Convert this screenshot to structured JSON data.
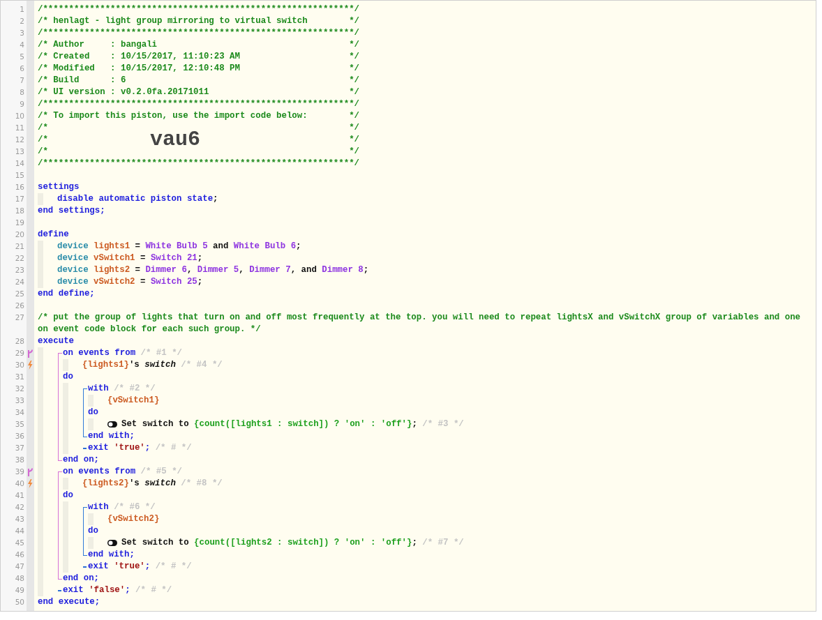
{
  "editor": {
    "lines": [
      {
        "kind": "line",
        "num": "1",
        "segments": [
          {
            "kind": "comment",
            "text": "/************************************************************/"
          }
        ]
      },
      {
        "kind": "line",
        "num": "2",
        "segments": [
          {
            "kind": "comment",
            "text": "/* henlagt - light group mirroring to virtual switch"
          }
        ],
        "tail": "*/"
      },
      {
        "kind": "line",
        "num": "3",
        "segments": [
          {
            "kind": "comment",
            "text": "/************************************************************/"
          }
        ]
      },
      {
        "kind": "line",
        "num": "4",
        "segments": [
          {
            "kind": "comment",
            "text": "/* Author     : bangali"
          }
        ],
        "tail": "*/"
      },
      {
        "kind": "line",
        "num": "5",
        "segments": [
          {
            "kind": "comment",
            "text": "/* Created    : 10/15/2017, 11:10:23 AM"
          }
        ],
        "tail": "*/"
      },
      {
        "kind": "line",
        "num": "6",
        "segments": [
          {
            "kind": "comment",
            "text": "/* Modified   : 10/15/2017, 12:10:48 PM"
          }
        ],
        "tail": "*/"
      },
      {
        "kind": "line",
        "num": "7",
        "segments": [
          {
            "kind": "comment",
            "text": "/* Build      : 6"
          }
        ],
        "tail": "*/"
      },
      {
        "kind": "line",
        "num": "8",
        "segments": [
          {
            "kind": "comment",
            "text": "/* UI version : v0.2.0fa.20171011"
          }
        ],
        "tail": "*/"
      },
      {
        "kind": "line",
        "num": "9",
        "segments": [
          {
            "kind": "comment",
            "text": "/************************************************************/"
          }
        ]
      },
      {
        "kind": "line",
        "num": "10",
        "segments": [
          {
            "kind": "comment",
            "text": "/* To import this piston, use the import code below:"
          }
        ],
        "tail": "*/"
      },
      {
        "kind": "line",
        "num": "11",
        "segments": [
          {
            "kind": "comment",
            "text": "/*"
          }
        ],
        "tail": "*/"
      },
      {
        "kind": "line",
        "num": "12",
        "segments": [
          {
            "kind": "comment",
            "text": "/*"
          },
          {
            "kind": "importcode",
            "text": "vau6"
          }
        ],
        "tail": "*/"
      },
      {
        "kind": "line",
        "num": "13",
        "segments": [
          {
            "kind": "comment",
            "text": "/*"
          }
        ],
        "tail": "*/"
      },
      {
        "kind": "line",
        "num": "14",
        "segments": [
          {
            "kind": "comment",
            "text": "/************************************************************/"
          }
        ]
      },
      {
        "kind": "line",
        "num": "15"
      },
      {
        "kind": "line",
        "num": "16",
        "segments": [
          {
            "kind": "keyword",
            "text": "settings"
          }
        ],
        "children": [
          {
            "kind": "line",
            "num": "17",
            "segments": [
              {
                "kind": "keyword",
                "text": "disable automatic piston state"
              },
              {
                "kind": "plain",
                "text": ";"
              }
            ]
          }
        ]
      },
      {
        "kind": "line",
        "num": "18",
        "segments": [
          {
            "kind": "keyword",
            "text": "end settings;"
          }
        ]
      },
      {
        "kind": "line",
        "num": "19"
      },
      {
        "kind": "line",
        "num": "20",
        "segments": [
          {
            "kind": "keyword",
            "text": "define"
          }
        ],
        "children": [
          {
            "kind": "line",
            "num": "21",
            "segments": [
              {
                "kind": "type",
                "text": "device "
              },
              {
                "kind": "variable",
                "text": "lights1"
              },
              {
                "kind": "plain",
                "text": " = "
              },
              {
                "kind": "device",
                "text": "White Bulb 5"
              },
              {
                "kind": "plain",
                "text": " and "
              },
              {
                "kind": "device",
                "text": "White Bulb 6"
              },
              {
                "kind": "plain",
                "text": ";"
              }
            ]
          },
          {
            "kind": "line",
            "num": "22",
            "segments": [
              {
                "kind": "type",
                "text": "device "
              },
              {
                "kind": "variable",
                "text": "vSwitch1"
              },
              {
                "kind": "plain",
                "text": " = "
              },
              {
                "kind": "device",
                "text": "Switch 21"
              },
              {
                "kind": "plain",
                "text": ";"
              }
            ]
          },
          {
            "kind": "line",
            "num": "23",
            "segments": [
              {
                "kind": "type",
                "text": "device "
              },
              {
                "kind": "variable",
                "text": "lights2"
              },
              {
                "kind": "plain",
                "text": " = "
              },
              {
                "kind": "device",
                "text": "Dimmer 6"
              },
              {
                "kind": "plain",
                "text": ", "
              },
              {
                "kind": "device",
                "text": "Dimmer 5"
              },
              {
                "kind": "plain",
                "text": ", "
              },
              {
                "kind": "device",
                "text": "Dimmer 7"
              },
              {
                "kind": "plain",
                "text": ", and "
              },
              {
                "kind": "device",
                "text": "Dimmer 8"
              },
              {
                "kind": "plain",
                "text": ";"
              }
            ]
          },
          {
            "kind": "line",
            "num": "24",
            "segments": [
              {
                "kind": "type",
                "text": "device "
              },
              {
                "kind": "variable",
                "text": "vSwitch2"
              },
              {
                "kind": "plain",
                "text": " = "
              },
              {
                "kind": "device",
                "text": "Switch 25"
              },
              {
                "kind": "plain",
                "text": ";"
              }
            ]
          }
        ]
      },
      {
        "kind": "line",
        "num": "25",
        "segments": [
          {
            "kind": "keyword",
            "text": "end define;"
          }
        ]
      },
      {
        "kind": "line",
        "num": "26"
      },
      {
        "kind": "line",
        "num": "27",
        "segments": [
          {
            "kind": "comment",
            "text": "/* put the group of lights that turn on and off most frequently at the top. you will need to repeat lightsX and vSwitchX group of variables and one on event code block for each such group. */"
          }
        ]
      },
      {
        "kind": "line",
        "num": "28",
        "segments": [
          {
            "kind": "keyword",
            "text": "execute"
          }
        ],
        "children": [
          {
            "kind": "event_block",
            "lines": [
              {
                "kind": "event",
                "num": "29",
                "segments": [
                  {
                    "kind": "keyword",
                    "text": "on events from"
                  },
                  {
                    "kind": "note",
                    "text": " /* #1 */"
                  }
                ],
                "children": [
                  {
                    "kind": "trigger",
                    "num": "30",
                    "segments": [
                      {
                        "kind": "variable",
                        "text": "{lights1}"
                      },
                      {
                        "kind": "plain",
                        "text": "'s "
                      },
                      {
                        "kind": "attribute",
                        "text": "switch"
                      },
                      {
                        "kind": "note",
                        "text": " /* #4 */"
                      }
                    ]
                  }
                ]
              },
              {
                "kind": "line",
                "num": "31",
                "segments": [
                  {
                    "kind": "keyword",
                    "text": "do"
                  }
                ],
                "children": [
                  {
                    "kind": "with_block",
                    "lines": [
                      {
                        "kind": "line",
                        "num": "32",
                        "segments": [
                          {
                            "kind": "keyword",
                            "text": "with"
                          },
                          {
                            "kind": "note",
                            "text": " /* #2 */"
                          }
                        ],
                        "children": [
                          {
                            "kind": "line",
                            "num": "33",
                            "segments": [
                              {
                                "kind": "variable",
                                "text": "{vSwitch1}"
                              }
                            ]
                          }
                        ]
                      },
                      {
                        "kind": "line",
                        "num": "34",
                        "segments": [
                          {
                            "kind": "keyword",
                            "text": "do"
                          }
                        ],
                        "children": [
                          {
                            "kind": "action",
                            "num": "35",
                            "segments": [
                              {
                                "kind": "plain",
                                "text": "Set switch to "
                              },
                              {
                                "kind": "expression",
                                "text": "{count([lights1 : switch]) ? 'on' : 'off'}"
                              },
                              {
                                "kind": "plain",
                                "text": ";"
                              },
                              {
                                "kind": "note",
                                "text": " /* #3 */"
                              }
                            ]
                          }
                        ]
                      },
                      {
                        "kind": "line",
                        "num": "36",
                        "segments": [
                          {
                            "kind": "keyword",
                            "text": "end with;"
                          }
                        ]
                      }
                    ]
                  },
                  {
                    "kind": "exit",
                    "num": "37",
                    "segments": [
                      {
                        "kind": "keyword",
                        "text": "exit "
                      },
                      {
                        "kind": "string",
                        "text": "'true'"
                      },
                      {
                        "kind": "keyword",
                        "text": ";"
                      },
                      {
                        "kind": "note",
                        "text": " /* # */"
                      }
                    ]
                  }
                ]
              },
              {
                "kind": "line",
                "num": "38",
                "segments": [
                  {
                    "kind": "keyword",
                    "text": "end on;"
                  }
                ]
              }
            ]
          },
          {
            "kind": "event_block",
            "lines": [
              {
                "kind": "event",
                "num": "39",
                "segments": [
                  {
                    "kind": "keyword",
                    "text": "on events from"
                  },
                  {
                    "kind": "note",
                    "text": " /* #5 */"
                  }
                ],
                "children": [
                  {
                    "kind": "trigger",
                    "num": "40",
                    "segments": [
                      {
                        "kind": "variable",
                        "text": "{lights2}"
                      },
                      {
                        "kind": "plain",
                        "text": "'s "
                      },
                      {
                        "kind": "attribute",
                        "text": "switch"
                      },
                      {
                        "kind": "note",
                        "text": " /* #8 */"
                      }
                    ]
                  }
                ]
              },
              {
                "kind": "line",
                "num": "41",
                "segments": [
                  {
                    "kind": "keyword",
                    "text": "do"
                  }
                ],
                "children": [
                  {
                    "kind": "with_block",
                    "lines": [
                      {
                        "kind": "line",
                        "num": "42",
                        "segments": [
                          {
                            "kind": "keyword",
                            "text": "with"
                          },
                          {
                            "kind": "note",
                            "text": " /* #6 */"
                          }
                        ],
                        "children": [
                          {
                            "kind": "line",
                            "num": "43",
                            "segments": [
                              {
                                "kind": "variable",
                                "text": "{vSwitch2}"
                              }
                            ]
                          }
                        ]
                      },
                      {
                        "kind": "line",
                        "num": "44",
                        "segments": [
                          {
                            "kind": "keyword",
                            "text": "do"
                          }
                        ],
                        "children": [
                          {
                            "kind": "action",
                            "num": "45",
                            "segments": [
                              {
                                "kind": "plain",
                                "text": "Set switch to "
                              },
                              {
                                "kind": "expression",
                                "text": "{count([lights2 : switch]) ? 'on' : 'off'}"
                              },
                              {
                                "kind": "plain",
                                "text": ";"
                              },
                              {
                                "kind": "note",
                                "text": " /* #7 */"
                              }
                            ]
                          }
                        ]
                      },
                      {
                        "kind": "line",
                        "num": "46",
                        "segments": [
                          {
                            "kind": "keyword",
                            "text": "end with;"
                          }
                        ]
                      }
                    ]
                  },
                  {
                    "kind": "exit",
                    "num": "47",
                    "segments": [
                      {
                        "kind": "keyword",
                        "text": "exit "
                      },
                      {
                        "kind": "string",
                        "text": "'true'"
                      },
                      {
                        "kind": "keyword",
                        "text": ";"
                      },
                      {
                        "kind": "note",
                        "text": " /* # */"
                      }
                    ]
                  }
                ]
              },
              {
                "kind": "line",
                "num": "48",
                "segments": [
                  {
                    "kind": "keyword",
                    "text": "end on;"
                  }
                ]
              }
            ]
          },
          {
            "kind": "exit",
            "num": "49",
            "segments": [
              {
                "kind": "keyword",
                "text": "exit "
              },
              {
                "kind": "string",
                "text": "'false'"
              },
              {
                "kind": "keyword",
                "text": ";"
              },
              {
                "kind": "note",
                "text": " /* # */"
              }
            ]
          }
        ]
      },
      {
        "kind": "line",
        "num": "50",
        "segments": [
          {
            "kind": "keyword",
            "text": "end execute;"
          }
        ]
      }
    ]
  }
}
